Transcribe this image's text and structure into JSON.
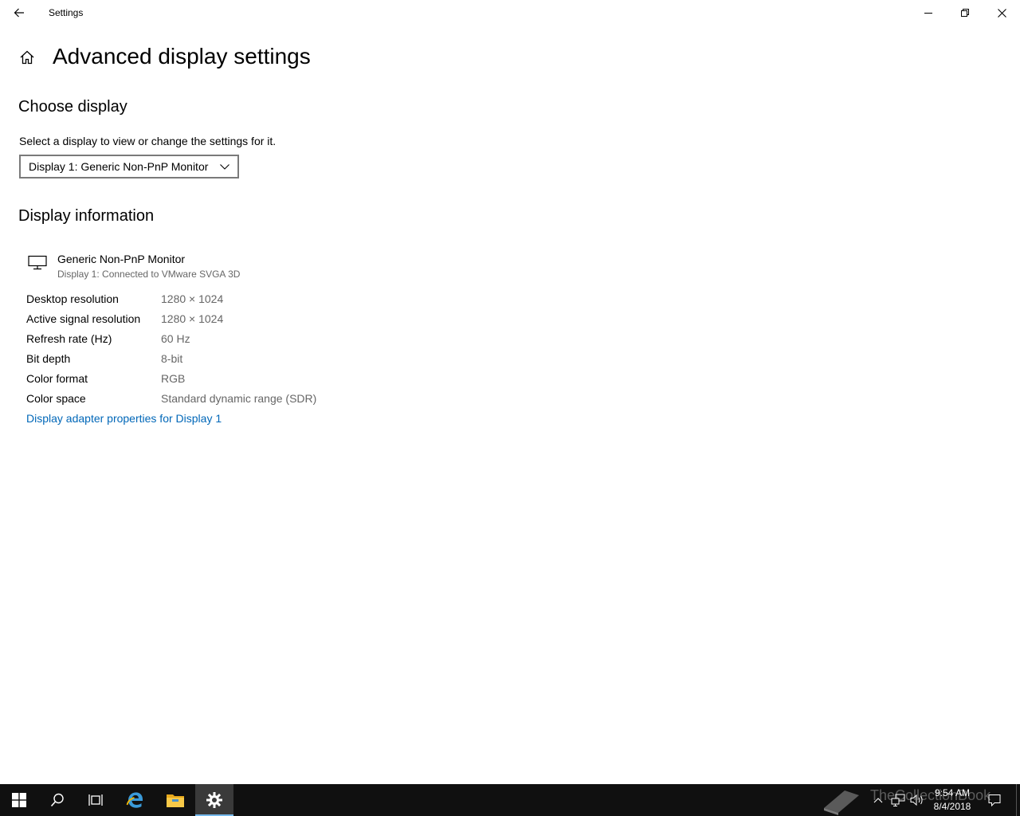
{
  "window": {
    "title": "Settings"
  },
  "page": {
    "title": "Advanced display settings"
  },
  "choose_display": {
    "heading": "Choose display",
    "description": "Select a display to view or change the settings for it.",
    "selected": "Display 1: Generic Non-PnP Monitor"
  },
  "display_info": {
    "heading": "Display information",
    "monitor_name": "Generic Non-PnP Monitor",
    "monitor_connection": "Display 1: Connected to VMware SVGA 3D",
    "rows": [
      {
        "label": "Desktop resolution",
        "value": "1280 × 1024"
      },
      {
        "label": "Active signal resolution",
        "value": "1280 × 1024"
      },
      {
        "label": "Refresh rate (Hz)",
        "value": "60 Hz"
      },
      {
        "label": "Bit depth",
        "value": "8-bit"
      },
      {
        "label": "Color format",
        "value": "RGB"
      },
      {
        "label": "Color space",
        "value": "Standard dynamic range (SDR)"
      }
    ],
    "adapter_link": "Display adapter properties for Display 1"
  },
  "taskbar": {
    "apps": [
      "start-icon",
      "search-icon",
      "task-view-icon",
      "edge-icon",
      "file-explorer-icon",
      "settings-icon"
    ],
    "active_app": "settings-icon",
    "watermark": "TheCollectionBook",
    "time": "9:54 AM",
    "date": "8/4/2018"
  },
  "colors": {
    "link": "#0067b8",
    "taskbar": "#101010",
    "secondary_text": "#666666"
  }
}
